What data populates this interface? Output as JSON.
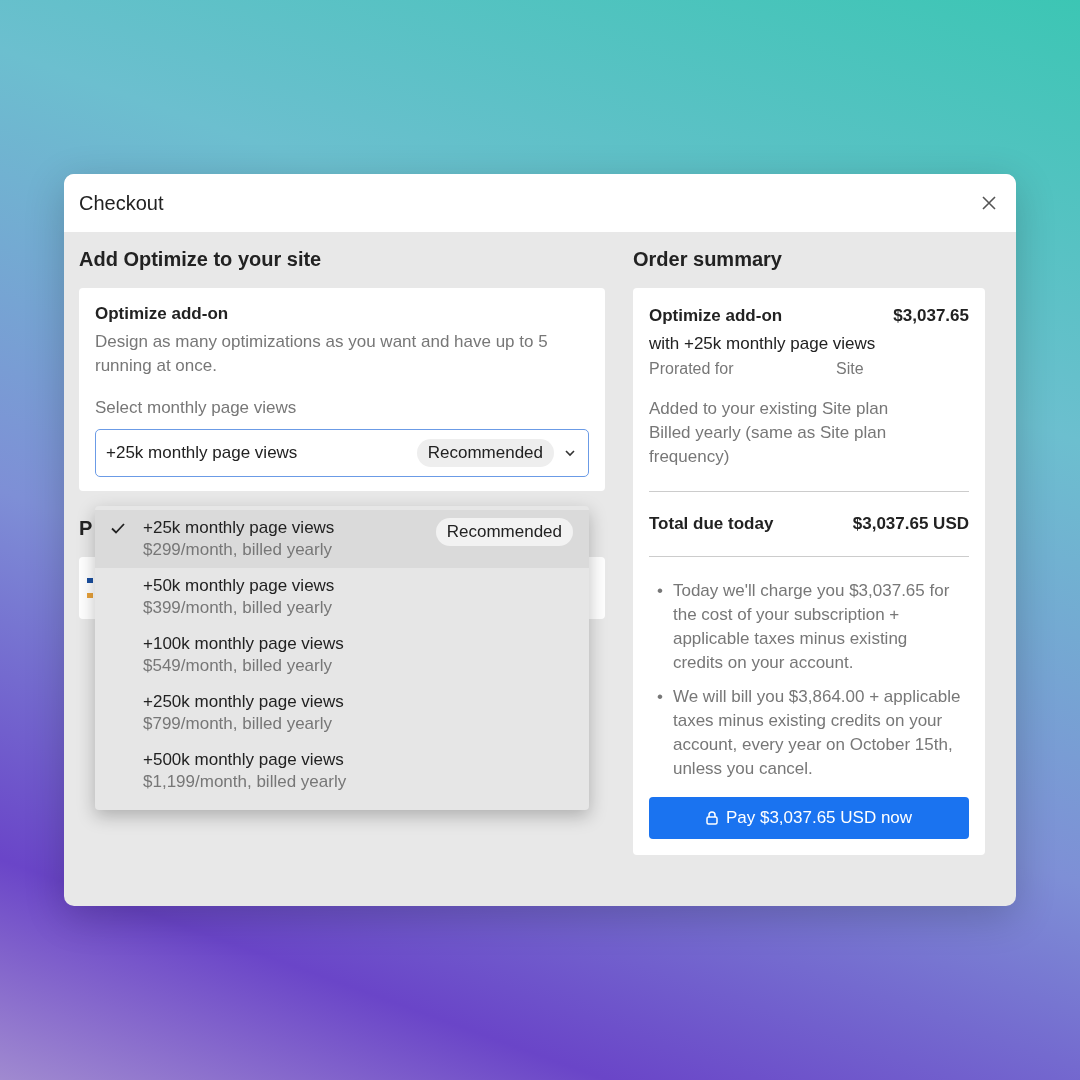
{
  "window": {
    "title": "Checkout"
  },
  "addon_section": {
    "heading": "Add Optimize to your site",
    "card": {
      "title": "Optimize add-on",
      "description": "Design as many optimizations as you want and have up to 5 running at once.",
      "select_label": "Select monthly page views",
      "select_value": "+25k monthly page views",
      "select_badge": "Recommended",
      "expanded": true
    }
  },
  "options": [
    {
      "label": "+25k monthly page views",
      "price": "$299/month, billed yearly",
      "badge": "Recommended",
      "selected": true
    },
    {
      "label": "+50k monthly page views",
      "price": "$399/month, billed yearly",
      "selected": false
    },
    {
      "label": "+100k monthly page views",
      "price": "$549/month, billed yearly",
      "selected": false
    },
    {
      "label": "+250k monthly page views",
      "price": "$799/month, billed yearly",
      "selected": false
    },
    {
      "label": "+500k monthly page views",
      "price": "$1,199/month, billed yearly",
      "selected": false
    }
  ],
  "payment_section": {
    "heading": "P"
  },
  "order_summary": {
    "heading": "Order summary",
    "item": "Optimize add-on",
    "item_price": "$3,037.65",
    "item_detail": "with +25k monthly page views",
    "prorated_label": "Prorated for",
    "prorated_value": "Site",
    "notes": [
      "Added to your existing Site plan",
      "Billed yearly (same as Site plan frequency)"
    ],
    "total_label": "Total due today",
    "total_value": "$3,037.65 USD",
    "bullets": [
      {
        "marker": "•",
        "text": "Today we'll charge you $3,037.65 for the cost of your subscription + applicable taxes minus existing credits on your account."
      },
      {
        "marker": "•",
        "text": "We will bill you $3,864.00 + applicable taxes minus existing credits on your account, every year on October 15th, unless you cancel."
      }
    ],
    "pay_button": "Pay $3,037.65 USD now"
  }
}
